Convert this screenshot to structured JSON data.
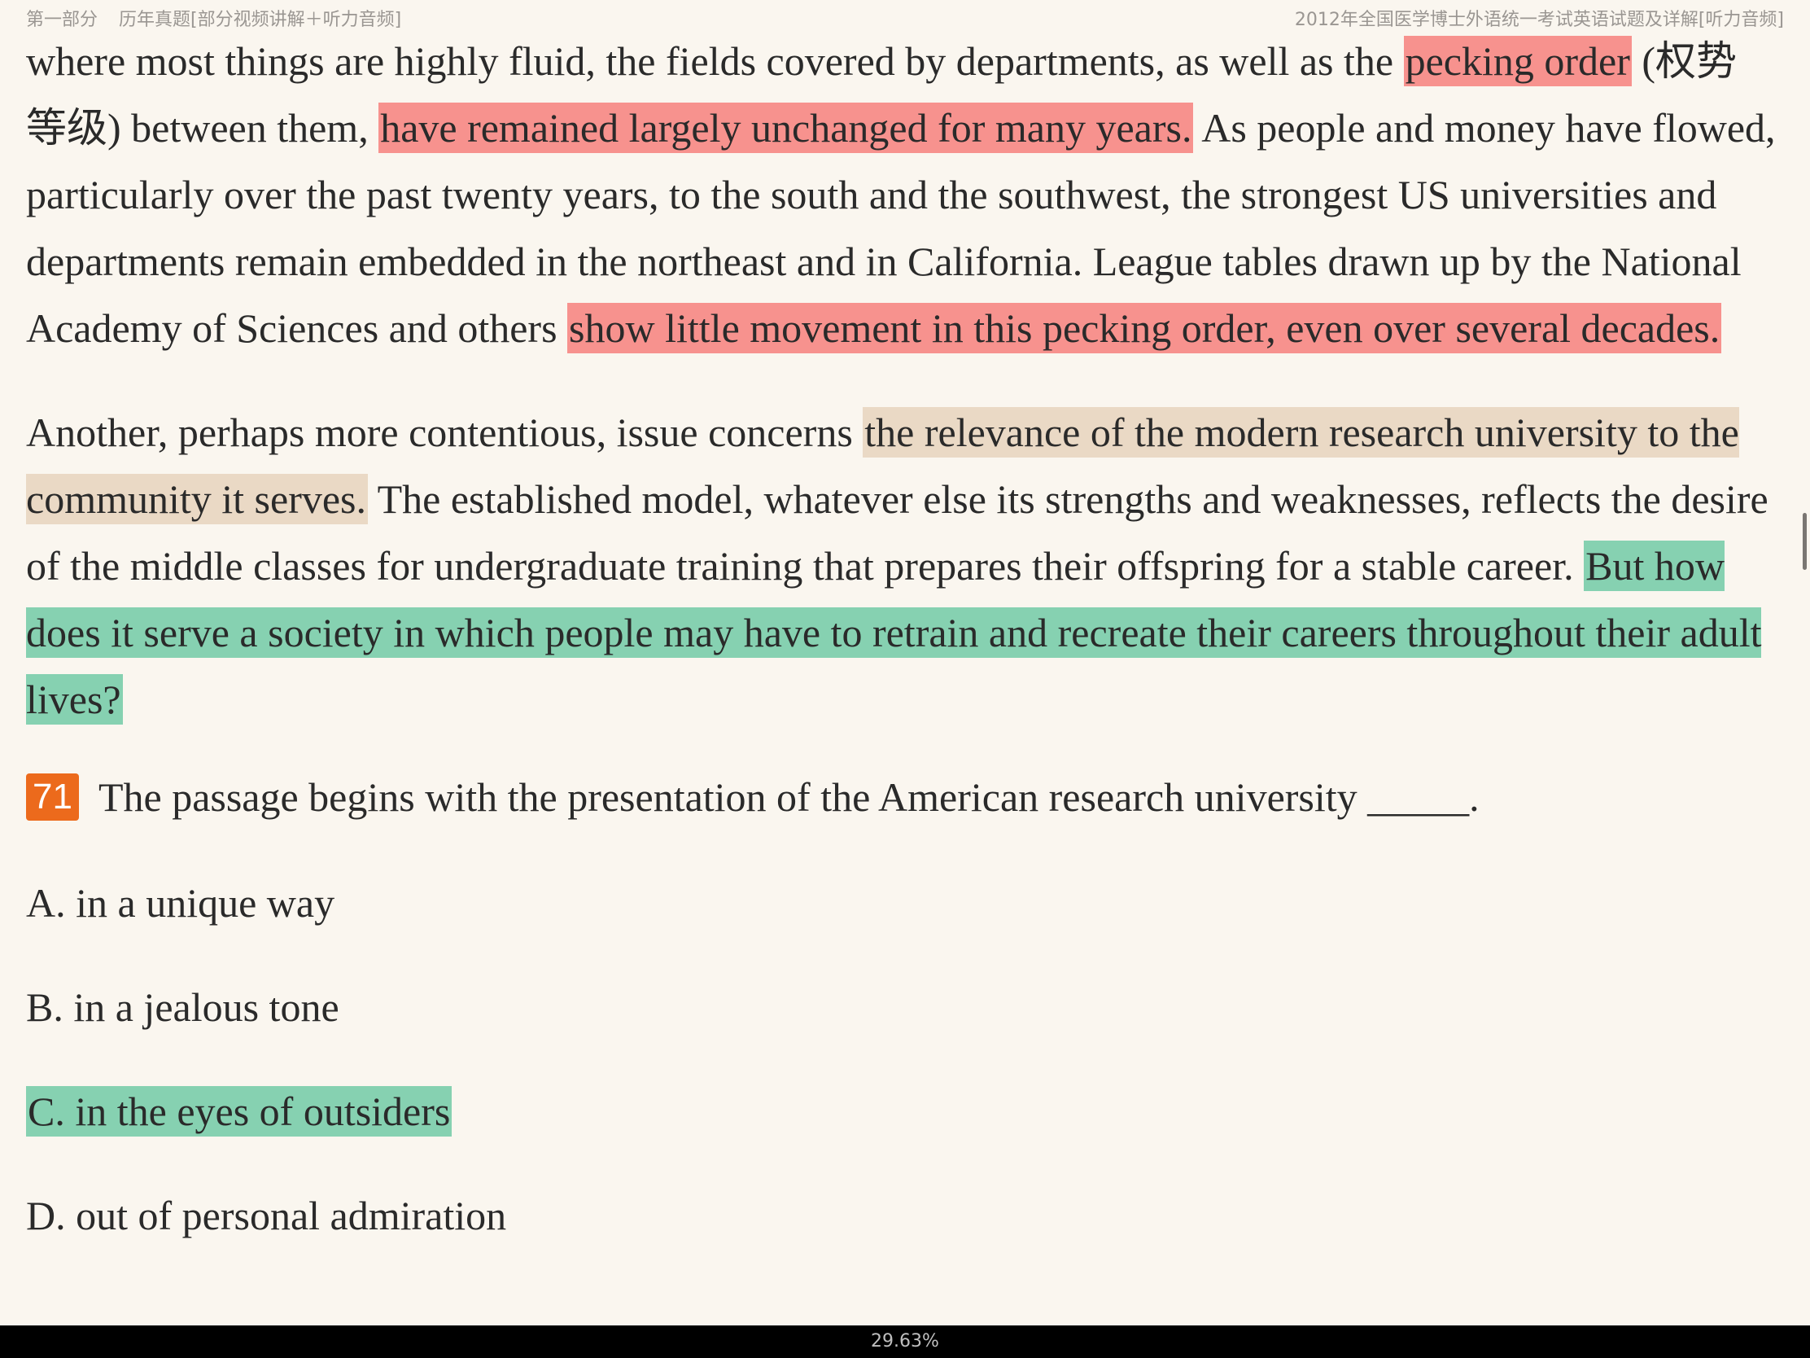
{
  "header": {
    "section": "第一部分",
    "chapter": "历年真题[部分视频讲解＋听力音频]",
    "book_title": "2012年全国医学博士外语统一考试英语试题及详解[听力音频]"
  },
  "passage": {
    "p1": {
      "t1": "where most things are highly fluid, the fields covered by departments, as well as the ",
      "h1": "pecking order",
      "t2": " (权势等级) between them, ",
      "h2": "have remained largely unchanged for many years.",
      "t3": " As people and money have flowed, particularly over the past twenty years, to the south and the southwest, the strongest US universities and departments remain embedded in the northeast and in California. League tables drawn up by the National Academy of Sciences and others ",
      "h3": "show little movement in this pecking order, even over several decades."
    },
    "p2": {
      "t1": "Another, perhaps more contentious, issue concerns ",
      "h1": "the relevance of the modern research university to the community it serves.",
      "t2": " The established model, whatever else its strengths and weaknesses, reflects the desire of the middle classes for undergraduate training that prepares their offspring for a stable career. ",
      "h2": "But how does it serve a society in which people may have to retrain and recreate their careers throughout their adult lives?"
    }
  },
  "question": {
    "number": "71",
    "text": "The passage begins with the presentation of the American research university _____.",
    "options": [
      "A. in a unique way",
      "B. in a jealous tone",
      "C. in the eyes of outsiders",
      "D. out of personal admiration"
    ]
  },
  "footer": {
    "progress": "29.63%"
  },
  "colors": {
    "highlight_red": "#f7928e",
    "highlight_tan": "#ead9c5",
    "highlight_green": "#86d1b1",
    "question_badge": "#ec6a1c"
  }
}
